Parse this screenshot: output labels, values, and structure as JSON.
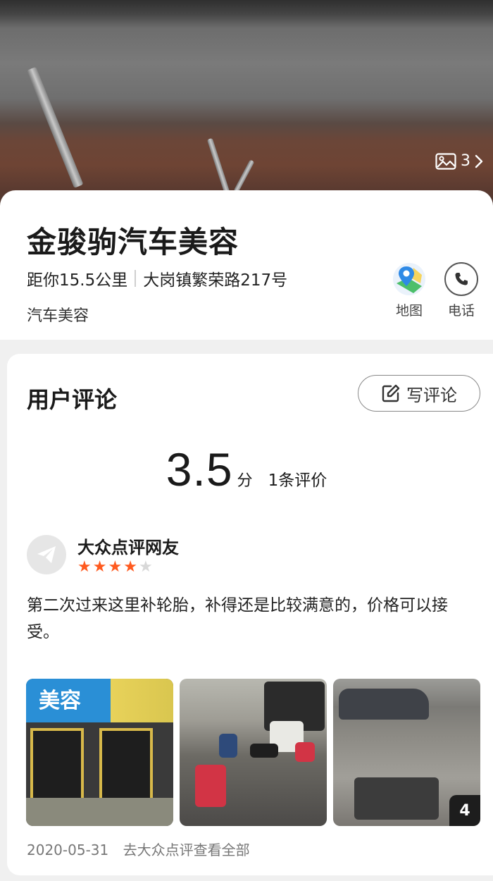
{
  "hero": {
    "photo_count": "3"
  },
  "shop": {
    "name": "金骏驹汽车美容",
    "distance": "距你15.5公里",
    "address": "大岗镇繁荣路217号",
    "category": "汽车美容"
  },
  "actions": {
    "map_label": "地图",
    "phone_label": "电话"
  },
  "reviews": {
    "title": "用户评论",
    "write_label": "写评论",
    "score": "3.5",
    "score_unit": "分",
    "count_text": "1条评价",
    "items": [
      {
        "user": "大众点评网友",
        "rating": 4,
        "rating_max": 5,
        "text": "第二次过来这里补轮胎，补得还是比较满意的，价格可以接受。",
        "photos": [
          {
            "sign_text": "美容"
          },
          {},
          {
            "more_count": "4"
          }
        ],
        "date": "2020-05-31",
        "source_link": "去大众点评查看全部"
      }
    ]
  },
  "colors": {
    "star_on": "#ff5a1f",
    "star_off": "#d8d8d8",
    "map_pin": "#2f8ae6",
    "map_green": "#4cbf6a"
  }
}
